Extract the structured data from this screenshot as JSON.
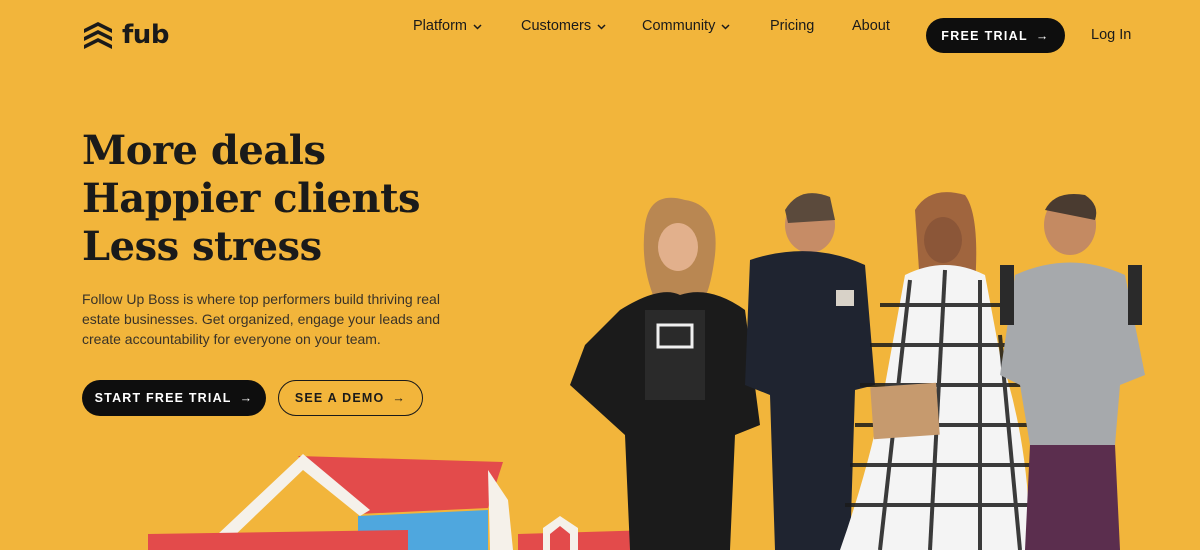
{
  "brand": {
    "name": "fub",
    "logo_icon": "stacked-chevrons-icon"
  },
  "nav": {
    "platform": "Platform",
    "customers": "Customers",
    "community": "Community",
    "pricing": "Pricing",
    "about": "About",
    "chevron_glyph": "⌄",
    "free_trial": "FREE TRIAL",
    "login": "Log In"
  },
  "hero": {
    "headline": [
      "More deals",
      "Happier clients",
      "Less stress"
    ],
    "subtext": "Follow Up Boss is where top performers build thriving real estate businesses. Get organized, engage your leads and create accountability for everyone on your team.",
    "start_trial": "START FREE TRIAL",
    "see_demo": "SEE A DEMO",
    "arrow": "→"
  },
  "colors": {
    "background": "#F2B53B",
    "dark": "#0E0E0E",
    "house_red": "#E34B4B",
    "house_blue": "#4FA7DE",
    "house_white": "#F5F1EA"
  }
}
